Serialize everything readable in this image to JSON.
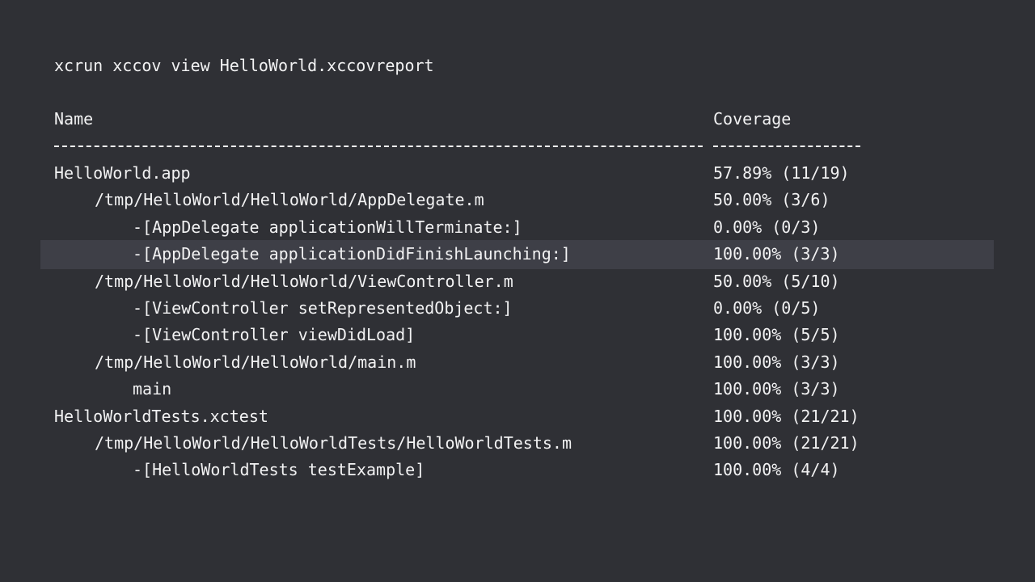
{
  "command": "xcrun xccov view HelloWorld.xccovreport",
  "headers": {
    "name": "Name",
    "coverage": "Coverage"
  },
  "rows": [
    {
      "name": "HelloWorld.app",
      "coverage": "57.89% (11/19)",
      "indent": 0
    },
    {
      "name": "/tmp/HelloWorld/HelloWorld/AppDelegate.m",
      "coverage": "50.00% (3/6)",
      "indent": 1
    },
    {
      "name": "-[AppDelegate applicationWillTerminate:]",
      "coverage": "0.00% (0/3)",
      "indent": 2
    },
    {
      "name": "-[AppDelegate applicationDidFinishLaunching:]",
      "coverage": "100.00% (3/3)",
      "indent": 2
    },
    {
      "name": "/tmp/HelloWorld/HelloWorld/ViewController.m",
      "coverage": "50.00% (5/10)",
      "indent": 1
    },
    {
      "name": "-[ViewController setRepresentedObject:]",
      "coverage": "0.00% (0/5)",
      "indent": 2
    },
    {
      "name": "-[ViewController viewDidLoad]",
      "coverage": "100.00% (5/5)",
      "indent": 2
    },
    {
      "name": "/tmp/HelloWorld/HelloWorld/main.m",
      "coverage": "100.00% (3/3)",
      "indent": 1
    },
    {
      "name": "main",
      "coverage": "100.00% (3/3)",
      "indent": 2
    },
    {
      "name": "HelloWorldTests.xctest",
      "coverage": "100.00% (21/21)",
      "indent": 0
    },
    {
      "name": "/tmp/HelloWorld/HelloWorldTests/HelloWorldTests.m",
      "coverage": "100.00% (21/21)",
      "indent": 1
    },
    {
      "name": "-[HelloWorldTests testExample]",
      "coverage": "100.00% (4/4)",
      "indent": 2
    }
  ],
  "highlighted_row_index": 3,
  "colors": {
    "background": "#2f3035",
    "text": "#f2f2f3",
    "highlight": "#3e3f47"
  }
}
